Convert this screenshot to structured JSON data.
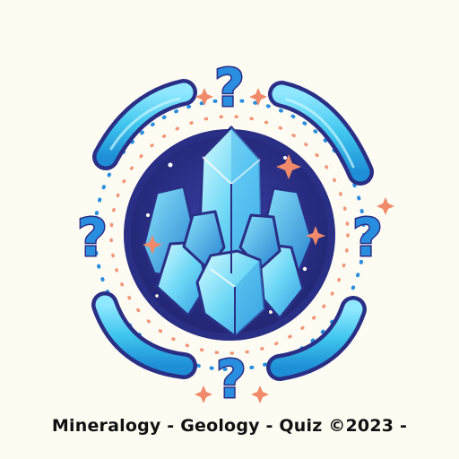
{
  "caption": "Mineralogy - Geology - Quiz ©2023 -",
  "question_mark_glyph": "?",
  "icons": [
    "crystal-cluster-icon",
    "question-mark-icon",
    "sparkle-icon"
  ],
  "colors": {
    "background": "#fdfbf2",
    "navy": "#2a2f86",
    "cyan": "#3fc6ee",
    "question_blue": "#2a8ee0",
    "accent_orange": "#f08a6a",
    "caption_text": "#111111"
  }
}
